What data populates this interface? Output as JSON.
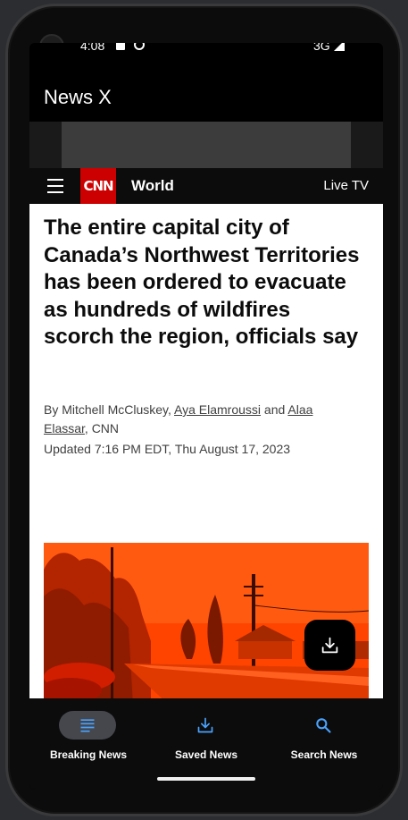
{
  "status_bar": {
    "time": "4:08",
    "network": "3G"
  },
  "app": {
    "title": "News X"
  },
  "cnn_header": {
    "logo_text": "CNN",
    "section": "World",
    "live_tv": "Live TV"
  },
  "article": {
    "headline": "The entire capital city of Canada’s Northwest Territories has been ordered to evacuate as hundreds of wildfires scorch the region, officials say",
    "byline_prefix": "By Mitchell McCluskey, ",
    "author_2": "Aya Elamroussi",
    "byline_and": " and ",
    "author_3": "Alaa Elassar",
    "byline_suffix": ", CNN",
    "updated": "Updated 7:16 PM EDT, Thu August 17, 2023"
  },
  "fab": {
    "icon": "download-icon"
  },
  "bottom_nav": {
    "items": [
      {
        "label": "Breaking News",
        "icon": "list-icon",
        "active": true
      },
      {
        "label": "Saved News",
        "icon": "download-icon",
        "active": false
      },
      {
        "label": "Search News",
        "icon": "search-icon",
        "active": false
      }
    ],
    "accent": "#4aa3ff"
  },
  "colors": {
    "cnn_red": "#cc0000",
    "hero_orange": "#ff4a00"
  }
}
